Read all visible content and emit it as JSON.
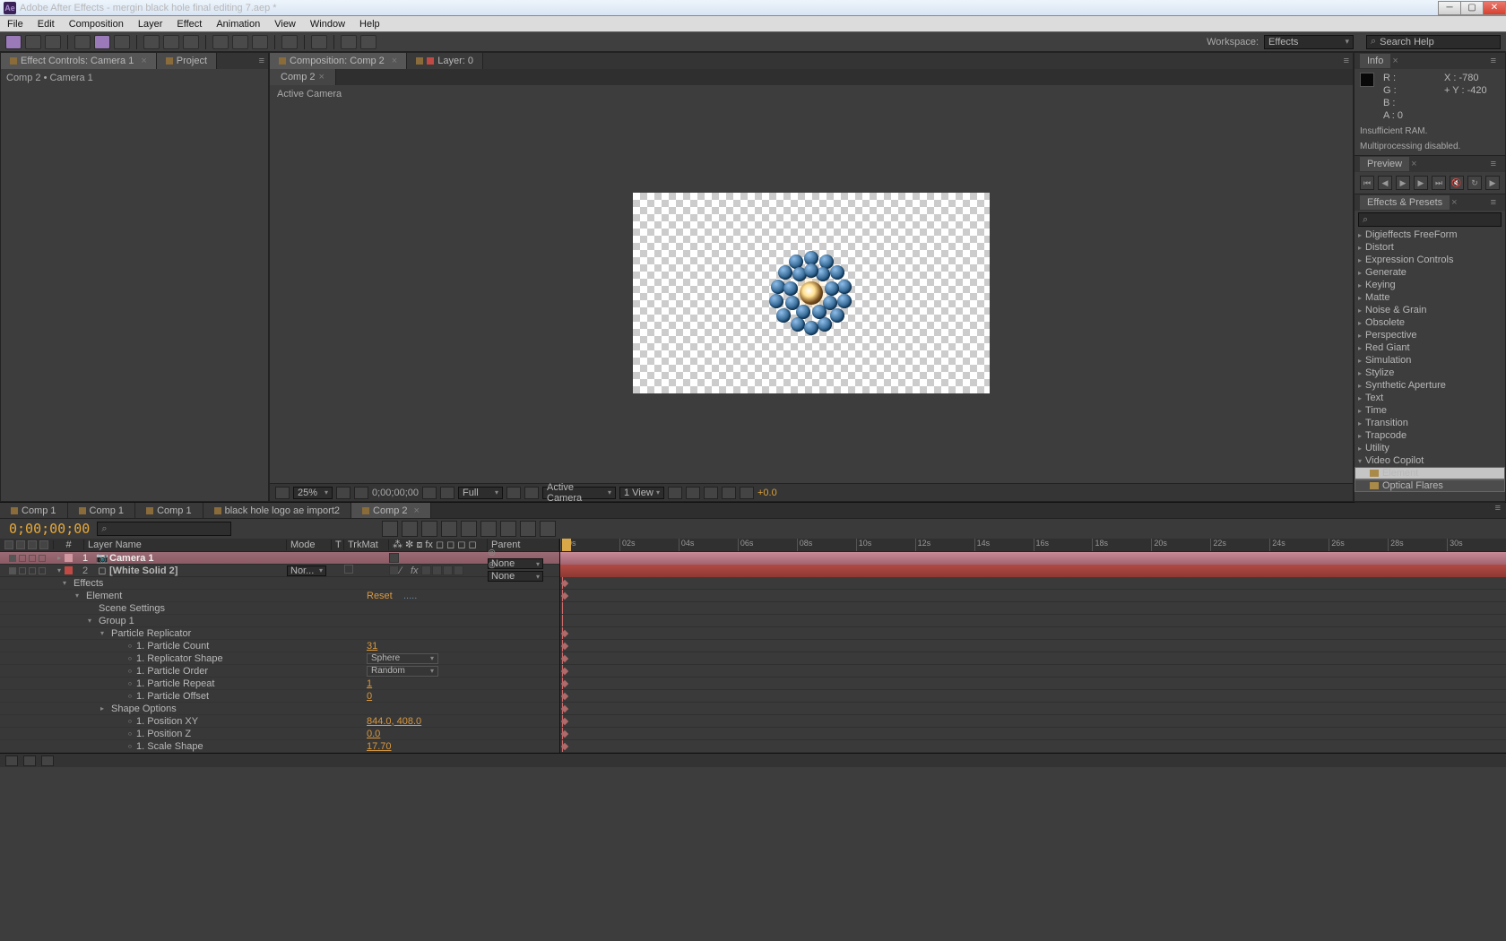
{
  "app": {
    "title": "Adobe After Effects - mergin black hole final editing 7.aep *"
  },
  "menu": [
    "File",
    "Edit",
    "Composition",
    "Layer",
    "Effect",
    "Animation",
    "View",
    "Window",
    "Help"
  ],
  "workspace": {
    "label": "Workspace:",
    "value": "Effects"
  },
  "search_help": {
    "placeholder": "Search Help"
  },
  "effect_controls": {
    "tab": "Effect Controls: Camera 1",
    "project_tab": "Project",
    "header": "Comp 2 • Camera 1"
  },
  "composition": {
    "tab": "Composition: Comp 2",
    "layer_tab": "Layer:  0",
    "sub": "Comp 2",
    "active_camera": "Active Camera"
  },
  "vp_footer": {
    "zoom": "25%",
    "time": "0;00;00;00",
    "res": "Full",
    "view_mode": "Active Camera",
    "views": "1 View",
    "exposure": "+0.0"
  },
  "info": {
    "title": "Info",
    "R": "R :",
    "G": "G :",
    "B": "B :",
    "A": "A :  0",
    "X": "X : -780",
    "Y": "Y :  -420",
    "cross": "+",
    "warn1": "Insufficient RAM.",
    "warn2": "Multiprocessing disabled."
  },
  "preview": {
    "title": "Preview"
  },
  "ep": {
    "title": "Effects & Presets",
    "list": [
      "Digieffects FreeForm",
      "Distort",
      "Expression Controls",
      "Generate",
      "Keying",
      "Matte",
      "Noise & Grain",
      "Obsolete",
      "Perspective",
      "Red Giant",
      "Simulation",
      "Stylize",
      "Synthetic Aperture",
      "Text",
      "Time",
      "Transition",
      "Trapcode",
      "Utility"
    ],
    "open": "Video Copilot",
    "subs": [
      "Element",
      "Optical Flares"
    ]
  },
  "tl_tabs": [
    "Comp 1",
    "Comp 1",
    "Comp 1",
    "black hole logo ae import2",
    "Comp 2"
  ],
  "timecode": "0;00;00;00",
  "columns": {
    "idx": "#",
    "name": "Layer Name",
    "mode": "Mode",
    "t": "T",
    "trk": "TrkMat",
    "parent": "Parent"
  },
  "layers": [
    {
      "idx": "1",
      "color": "#d198a1",
      "name": "Camera 1",
      "bold": true,
      "mode": "",
      "parent": "None",
      "camera": true
    },
    {
      "idx": "2",
      "color": "#c24a44",
      "name": "[White Solid 2]",
      "bold": true,
      "mode": "Nor...",
      "parent": "None"
    }
  ],
  "props": [
    {
      "ind": 0,
      "tw": "▾",
      "name": "Effects"
    },
    {
      "ind": 1,
      "tw": "▾",
      "name": "Element",
      "val_link": "Reset",
      "extra": "....."
    },
    {
      "ind": 2,
      "tw": "",
      "name": "Scene Settings"
    },
    {
      "ind": 2,
      "tw": "▾",
      "name": "Group 1"
    },
    {
      "ind": 3,
      "tw": "▾",
      "name": "Particle Replicator"
    },
    {
      "ind": 4,
      "kf": "⸰",
      "name": "1. Particle Count",
      "val": "31",
      "orange": true
    },
    {
      "ind": 4,
      "kf": "⸰",
      "name": "1. Replicator Shape",
      "dd": "Sphere"
    },
    {
      "ind": 4,
      "kf": "⸰",
      "name": "1. Particle Order",
      "dd": "Random"
    },
    {
      "ind": 4,
      "kf": "⸰",
      "name": "1. Particle Repeat",
      "val": "1",
      "orange": true
    },
    {
      "ind": 4,
      "kf": "⸰",
      "name": "1. Particle Offset",
      "val": "0",
      "orange": true
    },
    {
      "ind": 3,
      "tw": "▸",
      "name": "Shape Options"
    },
    {
      "ind": 4,
      "kf": "⸰",
      "name": "1. Position XY",
      "val": "844.0, 408.0",
      "orange": true
    },
    {
      "ind": 4,
      "kf": "⸰",
      "name": "1. Position Z",
      "val": "0.0",
      "orange": true
    },
    {
      "ind": 4,
      "kf": "⸰",
      "name": "1. Scale Shape",
      "val": "17.70",
      "orange": true
    }
  ],
  "ruler": [
    "00s",
    "02s",
    "04s",
    "06s",
    "08s",
    "10s",
    "12s",
    "14s",
    "16s",
    "18s",
    "20s",
    "22s",
    "24s",
    "26s",
    "28s",
    "30s"
  ]
}
